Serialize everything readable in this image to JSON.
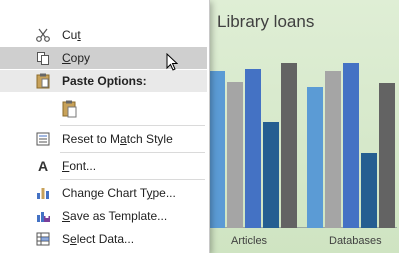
{
  "menu": {
    "items": [
      {
        "id": "cut",
        "label": "Cut",
        "icon": "scissors-icon"
      },
      {
        "id": "copy",
        "label": "Copy",
        "icon": "copy-icon",
        "highlighted": true
      },
      {
        "id": "paste_options",
        "label": "Paste Options:",
        "icon": "clipboard-icon",
        "header": true
      },
      {
        "id": "paste_keep",
        "label": "",
        "icon": "paste-icon"
      },
      {
        "id": "reset_style",
        "label": "Reset to Match Style",
        "icon": "reset-style-icon"
      },
      {
        "id": "font",
        "label": "Font...",
        "icon": "font-icon"
      },
      {
        "id": "change_chart_type",
        "label": "Change Chart Type...",
        "icon": "chart-type-icon"
      },
      {
        "id": "save_template",
        "label": "Save as Template...",
        "icon": "save-template-icon"
      },
      {
        "id": "select_data",
        "label": "Select Data...",
        "icon": "select-data-icon"
      }
    ]
  },
  "chart": {
    "title": "Library loans",
    "categories": [
      "Articles",
      "Databases"
    ]
  },
  "chart_data": {
    "type": "bar",
    "title": "Library loans",
    "categories": [
      "Articles",
      "Databases"
    ],
    "series": [
      {
        "values": [
          0.86,
          0.77
        ]
      },
      {
        "values": [
          0.8,
          0.86
        ]
      },
      {
        "values": [
          0.87,
          0.9
        ]
      },
      {
        "values": [
          0.58,
          0.41
        ]
      },
      {
        "values": [
          0.9,
          0.79
        ]
      }
    ],
    "colors": [
      "#5b9bd5",
      "#a5a5a5",
      "#4472c4",
      "#255e91",
      "#636363"
    ],
    "xlabel": "",
    "ylabel": "",
    "ylim": [
      0,
      1
    ],
    "grid": false
  },
  "cursor": {
    "icon": "mouse-pointer-icon"
  }
}
